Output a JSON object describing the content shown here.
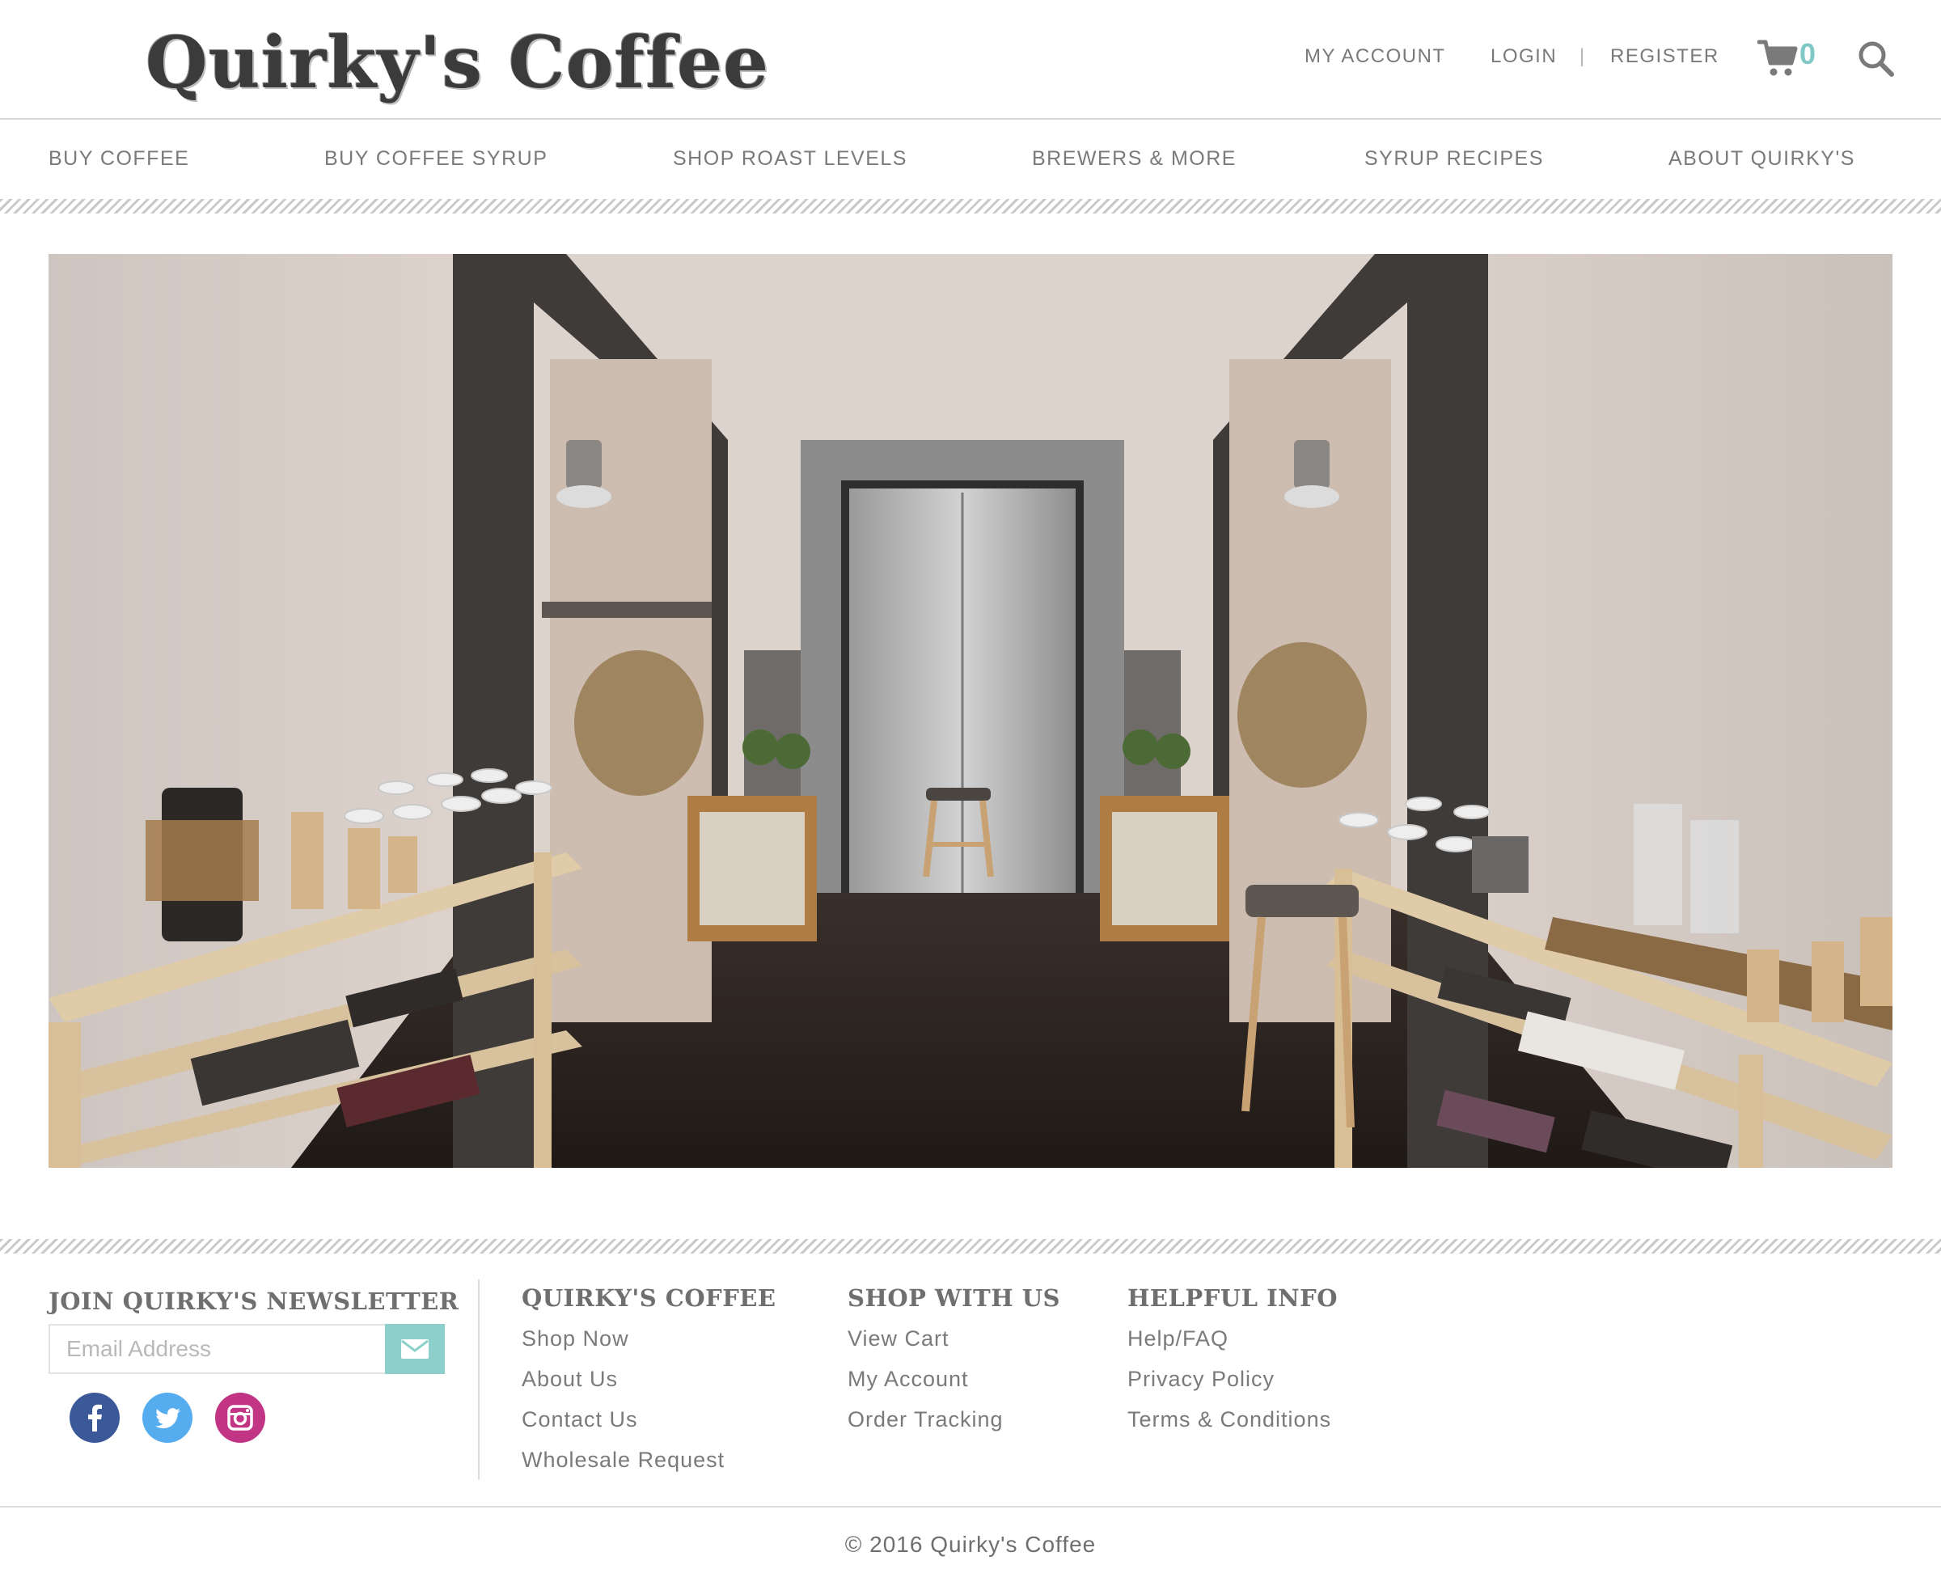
{
  "header": {
    "logo": "Quirky's Coffee",
    "my_account": "MY ACCOUNT",
    "login": "LOGIN",
    "separator": "|",
    "register": "REGISTER",
    "cart_count": "0",
    "cart_icon": "cart-icon",
    "search_icon": "search-icon"
  },
  "nav": {
    "items": [
      {
        "label": "BUY COFFEE"
      },
      {
        "label": "BUY COFFEE SYRUP"
      },
      {
        "label": "SHOP ROAST LEVELS"
      },
      {
        "label": "BREWERS & MORE"
      },
      {
        "label": "SYRUP RECIPES"
      },
      {
        "label": "ABOUT QUIRKY'S"
      }
    ]
  },
  "footer": {
    "newsletter": {
      "title": "JOIN QUIRKY'S NEWSLETTER",
      "placeholder": "Email Address",
      "submit_icon": "envelope-icon"
    },
    "social": [
      {
        "name": "facebook-icon",
        "color": "#3b5998"
      },
      {
        "name": "twitter-icon",
        "color": "#55acee"
      },
      {
        "name": "instagram-icon",
        "color": "#c13584"
      }
    ],
    "columns": [
      {
        "title": "QUIRKY'S COFFEE",
        "links": [
          "Shop Now",
          "About Us",
          "Contact Us",
          "Wholesale Request"
        ]
      },
      {
        "title": "SHOP WITH US",
        "links": [
          "View Cart",
          "My Account",
          "Order Tracking"
        ]
      },
      {
        "title": "HELPFUL INFO",
        "links": [
          "Help/FAQ",
          "Privacy Policy",
          "Terms & Conditions"
        ]
      }
    ],
    "copyright": "© 2016 Quirky's Coffee"
  },
  "colors": {
    "accent": "#8dd0cb",
    "cart_count": "#7fc8c5",
    "text": "#6f6f6f"
  }
}
